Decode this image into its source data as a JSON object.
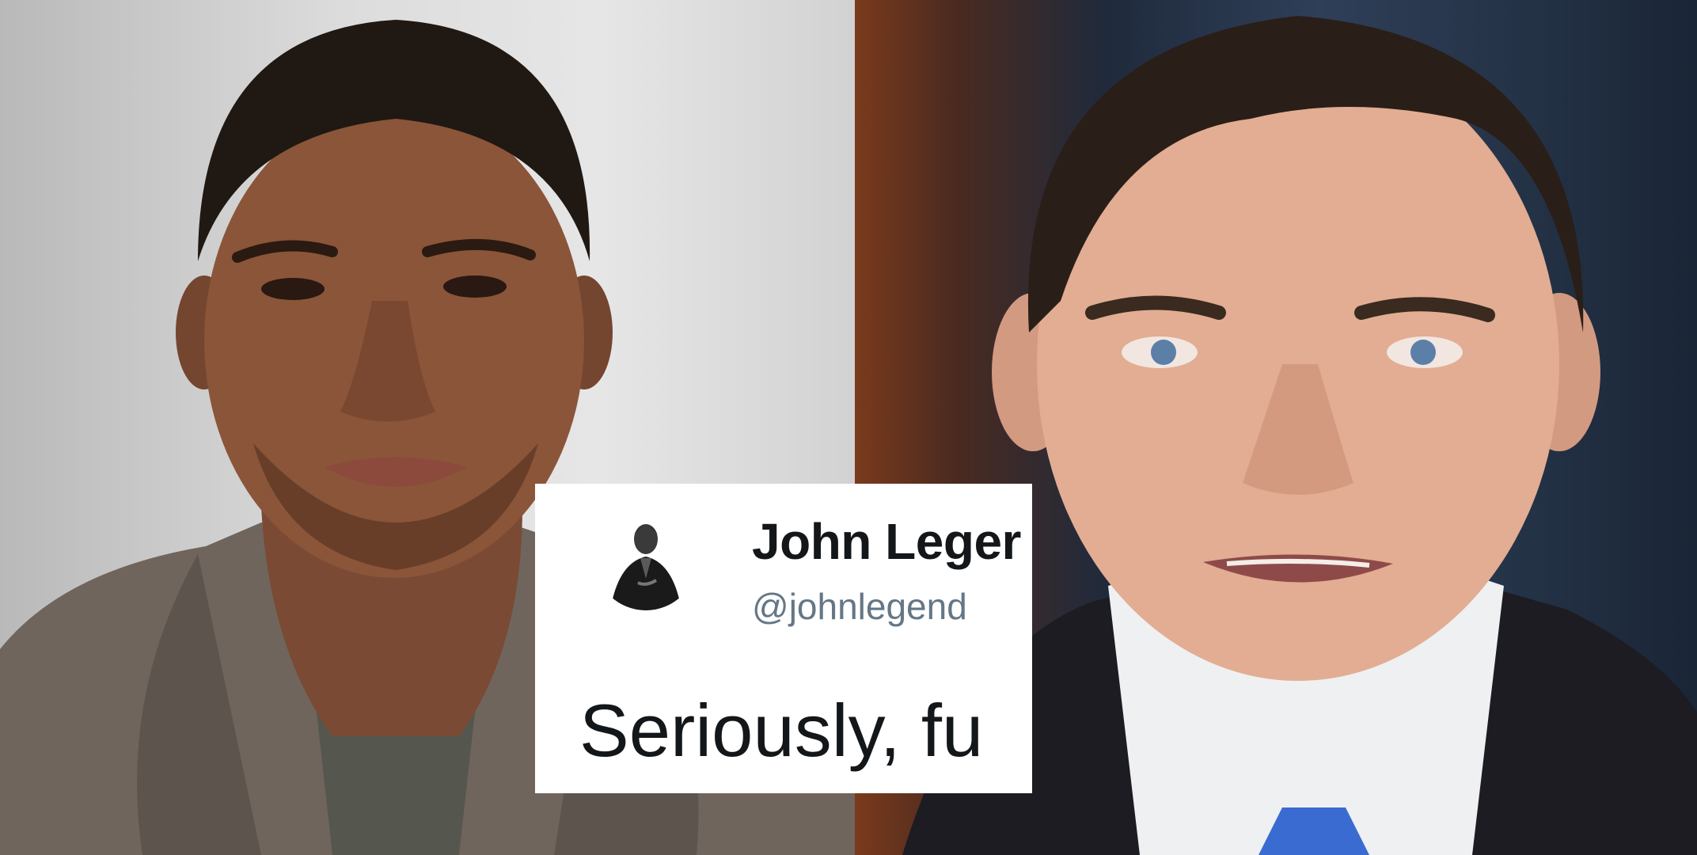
{
  "tweet": {
    "name": "John Leger",
    "handle": "@johnlegend",
    "text": "Seriously, fu"
  },
  "colors": {
    "name": "#14171a",
    "handle": "#657786",
    "card_background": "#ffffff"
  }
}
